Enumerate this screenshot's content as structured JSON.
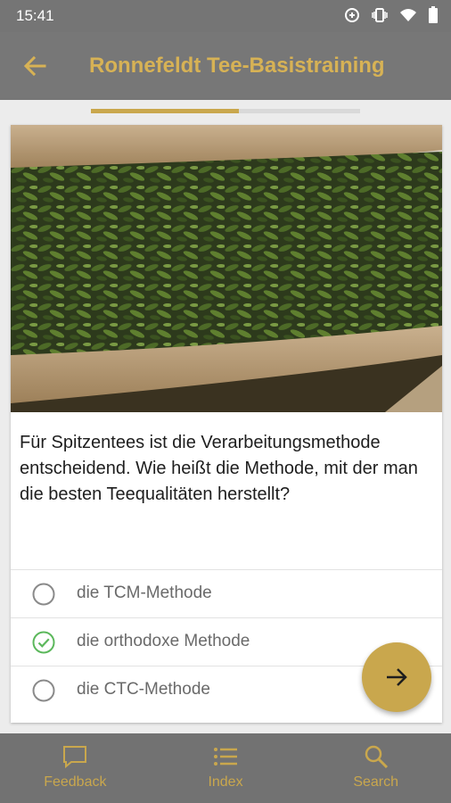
{
  "status_bar": {
    "time": "15:41"
  },
  "app_bar": {
    "title": "Ronnefeldt Tee-Basistraining"
  },
  "progress": {
    "fraction": 0.55
  },
  "question": {
    "text": "Für Spitzentees ist die Verarbeitungsmethode entscheidend. Wie heißt die Methode, mit der man die besten Teequalitäten herstellt?",
    "answers": [
      {
        "label": "die TCM-Methode",
        "selected": false
      },
      {
        "label": "die orthodoxe Methode",
        "selected": true
      },
      {
        "label": "die CTC-Methode",
        "selected": false
      }
    ]
  },
  "bottom_nav": [
    {
      "label": "Feedback",
      "icon": "chat-icon"
    },
    {
      "label": "Index",
      "icon": "list-icon"
    },
    {
      "label": "Search",
      "icon": "search-icon"
    }
  ],
  "colors": {
    "accent": "#c9a74d",
    "title": "#d7b255",
    "bar": "#777777",
    "check": "#5cb85c"
  }
}
